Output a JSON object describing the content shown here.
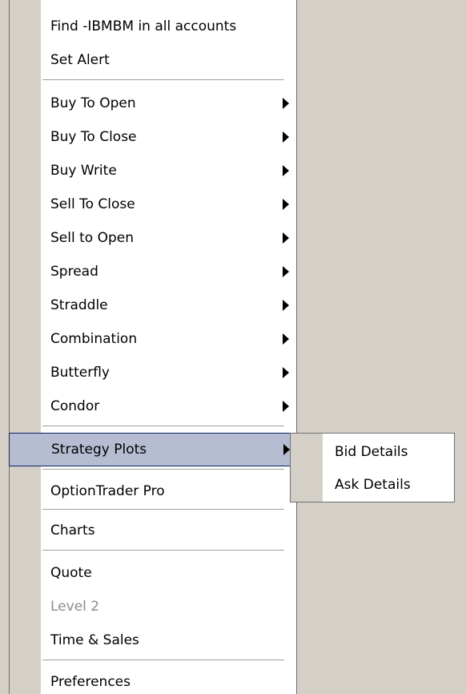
{
  "menu": {
    "items": [
      {
        "label": "Find -IBMBM in all accounts"
      },
      {
        "label": "Set Alert"
      },
      {
        "label": "Buy To Open"
      },
      {
        "label": "Buy To Close"
      },
      {
        "label": "Buy Write"
      },
      {
        "label": "Sell To Close"
      },
      {
        "label": "Sell to Open"
      },
      {
        "label": "Spread"
      },
      {
        "label": "Straddle"
      },
      {
        "label": "Combination"
      },
      {
        "label": "Butterfly"
      },
      {
        "label": "Condor"
      },
      {
        "label": "Strategy Plots"
      },
      {
        "label": "OptionTrader Pro"
      },
      {
        "label": "Charts"
      },
      {
        "label": "Quote"
      },
      {
        "label": "Level 2"
      },
      {
        "label": "Time & Sales"
      },
      {
        "label": "Preferences"
      }
    ],
    "highlight_color": "#b6bdd2",
    "disabled_color": "#8c8c8c"
  },
  "submenu": {
    "items": [
      {
        "label": "Bid Details"
      },
      {
        "label": "Ask Details"
      }
    ]
  }
}
